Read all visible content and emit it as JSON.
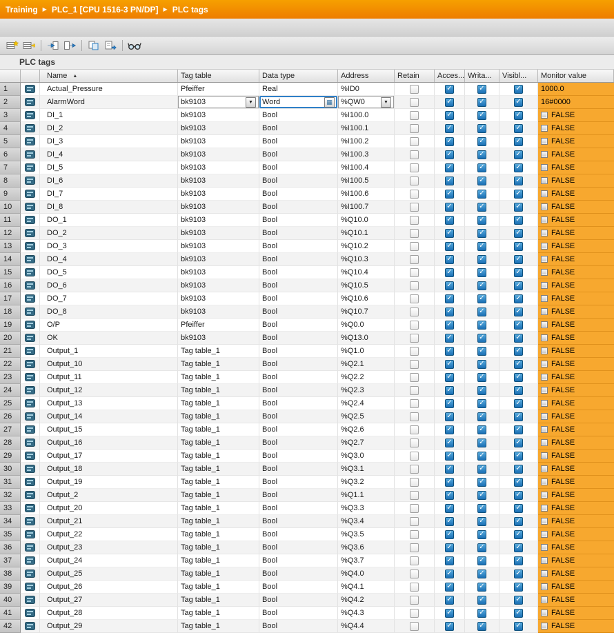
{
  "breadcrumb": {
    "items": [
      "Training",
      "PLC_1 [CPU 1516-3 PN/DP]",
      "PLC tags"
    ],
    "separator": "▶"
  },
  "toolbar": {
    "buttons": [
      {
        "name": "insert-row",
        "icon": "table-star-icon"
      },
      {
        "name": "add-row",
        "icon": "table-arrow-icon"
      },
      {
        "name": "import",
        "icon": "import-arrow-icon"
      },
      {
        "name": "export",
        "icon": "export-arrow-icon"
      },
      {
        "name": "snapshot",
        "icon": "pages-icon"
      },
      {
        "name": "apply-values",
        "icon": "pages-arrow-icon"
      },
      {
        "name": "monitor-all",
        "icon": "glasses-icon"
      }
    ]
  },
  "section_title": "PLC tags",
  "colors": {
    "accent_orange": "#ee7d00",
    "monitor_orange": "#f7a82f",
    "checkbox_blue": "#1a6fb4"
  },
  "table": {
    "columns": {
      "name": "Name",
      "tag_table": "Tag table",
      "data_type": "Data type",
      "address": "Address",
      "retain": "Retain",
      "accessible": "Acces...",
      "writable": "Writa...",
      "visible": "Visibl...",
      "monitor": "Monitor value"
    },
    "sort": {
      "column": "name",
      "direction": "ascending"
    },
    "rows": [
      {
        "n": 1,
        "name": "Actual_Pressure",
        "table": "Pfeiffer",
        "type": "Real",
        "addr": "%ID0",
        "retain": false,
        "acc": true,
        "wr": true,
        "vis": true,
        "mon": "1000.0",
        "mon_icon": false
      },
      {
        "n": 2,
        "name": "AlarmWord",
        "table": "bk9103",
        "type": "Word",
        "addr": "%QW0",
        "retain": false,
        "acc": true,
        "wr": true,
        "vis": true,
        "mon": "16#0000",
        "mon_icon": false,
        "editing": true
      },
      {
        "n": 3,
        "name": "DI_1",
        "table": "bk9103",
        "type": "Bool",
        "addr": "%I100.0",
        "retain": false,
        "acc": true,
        "wr": true,
        "vis": true,
        "mon": "FALSE",
        "mon_icon": true
      },
      {
        "n": 4,
        "name": "DI_2",
        "table": "bk9103",
        "type": "Bool",
        "addr": "%I100.1",
        "retain": false,
        "acc": true,
        "wr": true,
        "vis": true,
        "mon": "FALSE",
        "mon_icon": true
      },
      {
        "n": 5,
        "name": "DI_3",
        "table": "bk9103",
        "type": "Bool",
        "addr": "%I100.2",
        "retain": false,
        "acc": true,
        "wr": true,
        "vis": true,
        "mon": "FALSE",
        "mon_icon": true
      },
      {
        "n": 6,
        "name": "DI_4",
        "table": "bk9103",
        "type": "Bool",
        "addr": "%I100.3",
        "retain": false,
        "acc": true,
        "wr": true,
        "vis": true,
        "mon": "FALSE",
        "mon_icon": true
      },
      {
        "n": 7,
        "name": "DI_5",
        "table": "bk9103",
        "type": "Bool",
        "addr": "%I100.4",
        "retain": false,
        "acc": true,
        "wr": true,
        "vis": true,
        "mon": "FALSE",
        "mon_icon": true
      },
      {
        "n": 8,
        "name": "DI_6",
        "table": "bk9103",
        "type": "Bool",
        "addr": "%I100.5",
        "retain": false,
        "acc": true,
        "wr": true,
        "vis": true,
        "mon": "FALSE",
        "mon_icon": true
      },
      {
        "n": 9,
        "name": "DI_7",
        "table": "bk9103",
        "type": "Bool",
        "addr": "%I100.6",
        "retain": false,
        "acc": true,
        "wr": true,
        "vis": true,
        "mon": "FALSE",
        "mon_icon": true
      },
      {
        "n": 10,
        "name": "DI_8",
        "table": "bk9103",
        "type": "Bool",
        "addr": "%I100.7",
        "retain": false,
        "acc": true,
        "wr": true,
        "vis": true,
        "mon": "FALSE",
        "mon_icon": true
      },
      {
        "n": 11,
        "name": "DO_1",
        "table": "bk9103",
        "type": "Bool",
        "addr": "%Q10.0",
        "retain": false,
        "acc": true,
        "wr": true,
        "vis": true,
        "mon": "FALSE",
        "mon_icon": true
      },
      {
        "n": 12,
        "name": "DO_2",
        "table": "bk9103",
        "type": "Bool",
        "addr": "%Q10.1",
        "retain": false,
        "acc": true,
        "wr": true,
        "vis": true,
        "mon": "FALSE",
        "mon_icon": true
      },
      {
        "n": 13,
        "name": "DO_3",
        "table": "bk9103",
        "type": "Bool",
        "addr": "%Q10.2",
        "retain": false,
        "acc": true,
        "wr": true,
        "vis": true,
        "mon": "FALSE",
        "mon_icon": true
      },
      {
        "n": 14,
        "name": "DO_4",
        "table": "bk9103",
        "type": "Bool",
        "addr": "%Q10.3",
        "retain": false,
        "acc": true,
        "wr": true,
        "vis": true,
        "mon": "FALSE",
        "mon_icon": true
      },
      {
        "n": 15,
        "name": "DO_5",
        "table": "bk9103",
        "type": "Bool",
        "addr": "%Q10.4",
        "retain": false,
        "acc": true,
        "wr": true,
        "vis": true,
        "mon": "FALSE",
        "mon_icon": true
      },
      {
        "n": 16,
        "name": "DO_6",
        "table": "bk9103",
        "type": "Bool",
        "addr": "%Q10.5",
        "retain": false,
        "acc": true,
        "wr": true,
        "vis": true,
        "mon": "FALSE",
        "mon_icon": true
      },
      {
        "n": 17,
        "name": "DO_7",
        "table": "bk9103",
        "type": "Bool",
        "addr": "%Q10.6",
        "retain": false,
        "acc": true,
        "wr": true,
        "vis": true,
        "mon": "FALSE",
        "mon_icon": true
      },
      {
        "n": 18,
        "name": "DO_8",
        "table": "bk9103",
        "type": "Bool",
        "addr": "%Q10.7",
        "retain": false,
        "acc": true,
        "wr": true,
        "vis": true,
        "mon": "FALSE",
        "mon_icon": true
      },
      {
        "n": 19,
        "name": "O/P",
        "table": "Pfeiffer",
        "type": "Bool",
        "addr": "%Q0.0",
        "retain": false,
        "acc": true,
        "wr": true,
        "vis": true,
        "mon": "FALSE",
        "mon_icon": true
      },
      {
        "n": 20,
        "name": "OK",
        "table": "bk9103",
        "type": "Bool",
        "addr": "%Q13.0",
        "retain": false,
        "acc": true,
        "wr": true,
        "vis": true,
        "mon": "FALSE",
        "mon_icon": true
      },
      {
        "n": 21,
        "name": "Output_1",
        "table": "Tag table_1",
        "type": "Bool",
        "addr": "%Q1.0",
        "retain": false,
        "acc": true,
        "wr": true,
        "vis": true,
        "mon": "FALSE",
        "mon_icon": true
      },
      {
        "n": 22,
        "name": "Output_10",
        "table": "Tag table_1",
        "type": "Bool",
        "addr": "%Q2.1",
        "retain": false,
        "acc": true,
        "wr": true,
        "vis": true,
        "mon": "FALSE",
        "mon_icon": true
      },
      {
        "n": 23,
        "name": "Output_11",
        "table": "Tag table_1",
        "type": "Bool",
        "addr": "%Q2.2",
        "retain": false,
        "acc": true,
        "wr": true,
        "vis": true,
        "mon": "FALSE",
        "mon_icon": true
      },
      {
        "n": 24,
        "name": "Output_12",
        "table": "Tag table_1",
        "type": "Bool",
        "addr": "%Q2.3",
        "retain": false,
        "acc": true,
        "wr": true,
        "vis": true,
        "mon": "FALSE",
        "mon_icon": true
      },
      {
        "n": 25,
        "name": "Output_13",
        "table": "Tag table_1",
        "type": "Bool",
        "addr": "%Q2.4",
        "retain": false,
        "acc": true,
        "wr": true,
        "vis": true,
        "mon": "FALSE",
        "mon_icon": true
      },
      {
        "n": 26,
        "name": "Output_14",
        "table": "Tag table_1",
        "type": "Bool",
        "addr": "%Q2.5",
        "retain": false,
        "acc": true,
        "wr": true,
        "vis": true,
        "mon": "FALSE",
        "mon_icon": true
      },
      {
        "n": 27,
        "name": "Output_15",
        "table": "Tag table_1",
        "type": "Bool",
        "addr": "%Q2.6",
        "retain": false,
        "acc": true,
        "wr": true,
        "vis": true,
        "mon": "FALSE",
        "mon_icon": true
      },
      {
        "n": 28,
        "name": "Output_16",
        "table": "Tag table_1",
        "type": "Bool",
        "addr": "%Q2.7",
        "retain": false,
        "acc": true,
        "wr": true,
        "vis": true,
        "mon": "FALSE",
        "mon_icon": true
      },
      {
        "n": 29,
        "name": "Output_17",
        "table": "Tag table_1",
        "type": "Bool",
        "addr": "%Q3.0",
        "retain": false,
        "acc": true,
        "wr": true,
        "vis": true,
        "mon": "FALSE",
        "mon_icon": true
      },
      {
        "n": 30,
        "name": "Output_18",
        "table": "Tag table_1",
        "type": "Bool",
        "addr": "%Q3.1",
        "retain": false,
        "acc": true,
        "wr": true,
        "vis": true,
        "mon": "FALSE",
        "mon_icon": true
      },
      {
        "n": 31,
        "name": "Output_19",
        "table": "Tag table_1",
        "type": "Bool",
        "addr": "%Q3.2",
        "retain": false,
        "acc": true,
        "wr": true,
        "vis": true,
        "mon": "FALSE",
        "mon_icon": true
      },
      {
        "n": 32,
        "name": "Output_2",
        "table": "Tag table_1",
        "type": "Bool",
        "addr": "%Q1.1",
        "retain": false,
        "acc": true,
        "wr": true,
        "vis": true,
        "mon": "FALSE",
        "mon_icon": true
      },
      {
        "n": 33,
        "name": "Output_20",
        "table": "Tag table_1",
        "type": "Bool",
        "addr": "%Q3.3",
        "retain": false,
        "acc": true,
        "wr": true,
        "vis": true,
        "mon": "FALSE",
        "mon_icon": true
      },
      {
        "n": 34,
        "name": "Output_21",
        "table": "Tag table_1",
        "type": "Bool",
        "addr": "%Q3.4",
        "retain": false,
        "acc": true,
        "wr": true,
        "vis": true,
        "mon": "FALSE",
        "mon_icon": true
      },
      {
        "n": 35,
        "name": "Output_22",
        "table": "Tag table_1",
        "type": "Bool",
        "addr": "%Q3.5",
        "retain": false,
        "acc": true,
        "wr": true,
        "vis": true,
        "mon": "FALSE",
        "mon_icon": true
      },
      {
        "n": 36,
        "name": "Output_23",
        "table": "Tag table_1",
        "type": "Bool",
        "addr": "%Q3.6",
        "retain": false,
        "acc": true,
        "wr": true,
        "vis": true,
        "mon": "FALSE",
        "mon_icon": true
      },
      {
        "n": 37,
        "name": "Output_24",
        "table": "Tag table_1",
        "type": "Bool",
        "addr": "%Q3.7",
        "retain": false,
        "acc": true,
        "wr": true,
        "vis": true,
        "mon": "FALSE",
        "mon_icon": true
      },
      {
        "n": 38,
        "name": "Output_25",
        "table": "Tag table_1",
        "type": "Bool",
        "addr": "%Q4.0",
        "retain": false,
        "acc": true,
        "wr": true,
        "vis": true,
        "mon": "FALSE",
        "mon_icon": true
      },
      {
        "n": 39,
        "name": "Output_26",
        "table": "Tag table_1",
        "type": "Bool",
        "addr": "%Q4.1",
        "retain": false,
        "acc": true,
        "wr": true,
        "vis": true,
        "mon": "FALSE",
        "mon_icon": true
      },
      {
        "n": 40,
        "name": "Output_27",
        "table": "Tag table_1",
        "type": "Bool",
        "addr": "%Q4.2",
        "retain": false,
        "acc": true,
        "wr": true,
        "vis": true,
        "mon": "FALSE",
        "mon_icon": true
      },
      {
        "n": 41,
        "name": "Output_28",
        "table": "Tag table_1",
        "type": "Bool",
        "addr": "%Q4.3",
        "retain": false,
        "acc": true,
        "wr": true,
        "vis": true,
        "mon": "FALSE",
        "mon_icon": true
      },
      {
        "n": 42,
        "name": "Output_29",
        "table": "Tag table_1",
        "type": "Bool",
        "addr": "%Q4.4",
        "retain": false,
        "acc": true,
        "wr": true,
        "vis": true,
        "mon": "FALSE",
        "mon_icon": true
      }
    ]
  }
}
